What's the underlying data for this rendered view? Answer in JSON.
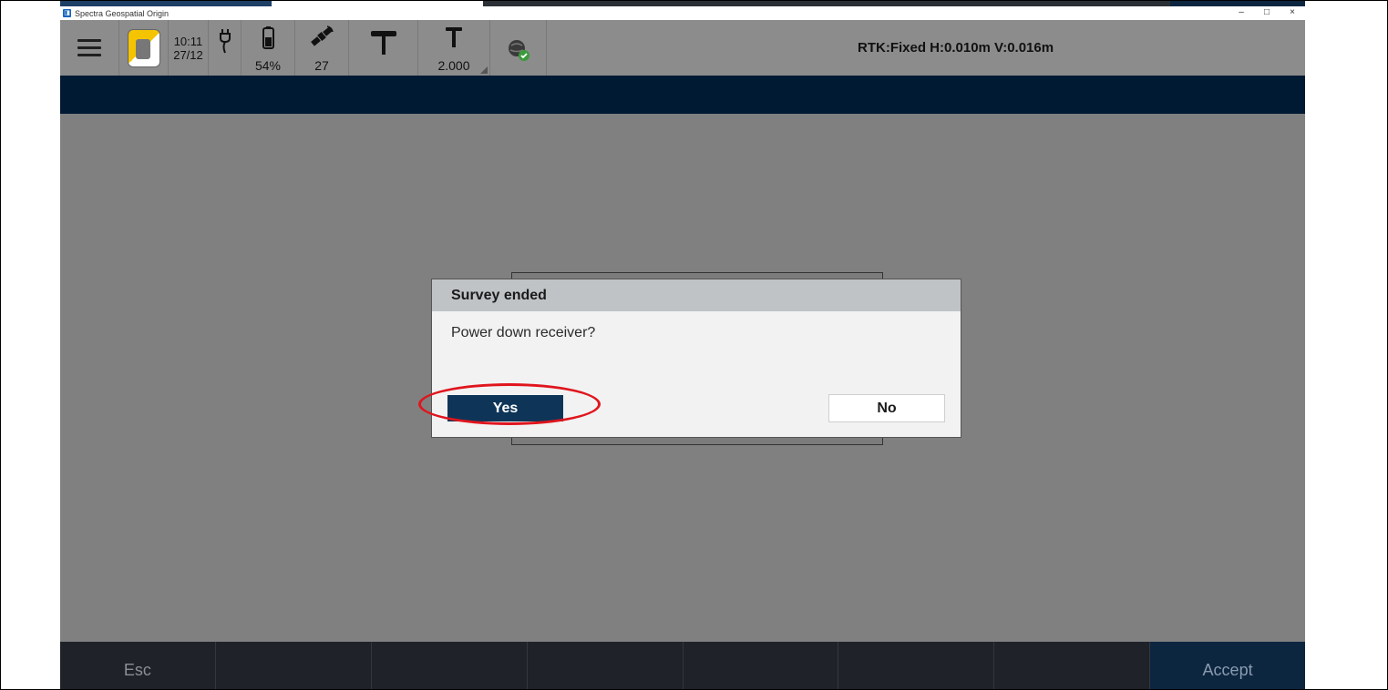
{
  "window": {
    "title": "Spectra Geospatial Origin",
    "controls": {
      "minimize": "–",
      "maximize": "□",
      "close": "×"
    }
  },
  "statusbar": {
    "time": "10:11",
    "date": "27/12",
    "battery": "54%",
    "satellites": "27",
    "antenna_height": "2.000",
    "rtk_status": "RTK:Fixed H:0.010m V:0.016m"
  },
  "dialog": {
    "title": "Survey ended",
    "message": "Power down receiver?",
    "yes_label": "Yes",
    "no_label": "No"
  },
  "bottom_bar": {
    "esc_label": "Esc",
    "accept_label": "Accept"
  },
  "colors": {
    "nav_band": "#011a33",
    "yes_button": "#0e3557",
    "highlight": "#e0151d",
    "background": "#808080"
  }
}
